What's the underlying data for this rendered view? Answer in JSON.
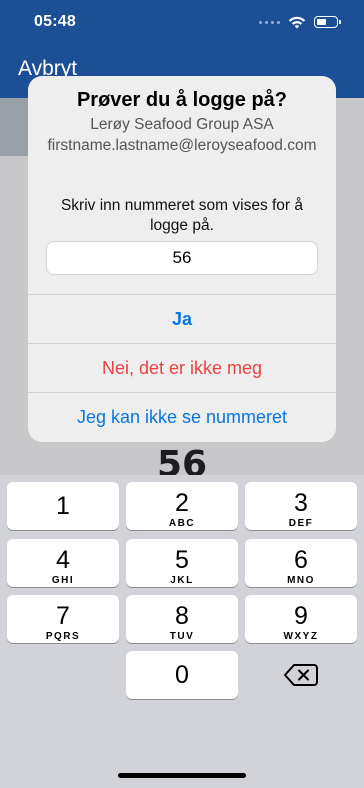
{
  "status_bar": {
    "time": "05:48"
  },
  "app": {
    "cancel_label": "Avbryt",
    "number_display": "56"
  },
  "alert": {
    "title": "Prøver du å logge på?",
    "organization": "Lerøy Seafood Group ASA",
    "email": "firstname.lastname@leroyseafood.com",
    "message": "Skriv inn nummeret som vises for å logge på.",
    "input_value": "56",
    "buttons": {
      "yes": "Ja",
      "no": "Nei, det er ikke meg",
      "cant_see": "Jeg kan ikke se nummeret"
    },
    "colors": {
      "primary": "#0a76e0",
      "destructive": "#e84343"
    }
  },
  "keypad": {
    "keys": [
      {
        "digit": "1",
        "letters": ""
      },
      {
        "digit": "2",
        "letters": "ABC"
      },
      {
        "digit": "3",
        "letters": "DEF"
      },
      {
        "digit": "4",
        "letters": "GHI"
      },
      {
        "digit": "5",
        "letters": "JKL"
      },
      {
        "digit": "6",
        "letters": "MNO"
      },
      {
        "digit": "7",
        "letters": "PQRS"
      },
      {
        "digit": "8",
        "letters": "TUV"
      },
      {
        "digit": "9",
        "letters": "WXYZ"
      },
      {
        "digit": "0",
        "letters": ""
      }
    ],
    "delete_icon": "backspace-icon"
  }
}
